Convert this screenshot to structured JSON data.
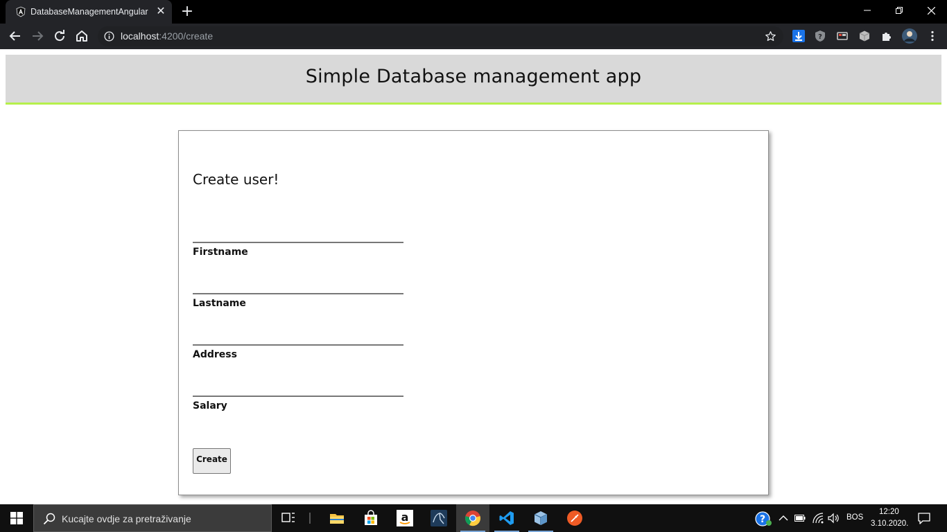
{
  "browser": {
    "tab_title": "DatabaseManagementAngular",
    "url_host": "localhost",
    "url_rest": ":4200/create",
    "window_controls": [
      "minimize",
      "restore",
      "close"
    ]
  },
  "app": {
    "title": "Simple Database management app"
  },
  "form": {
    "heading": "Create user!",
    "fields": [
      {
        "label": "Firstname",
        "value": ""
      },
      {
        "label": "Lastname",
        "value": ""
      },
      {
        "label": "Address",
        "value": ""
      },
      {
        "label": "Salary",
        "value": ""
      }
    ],
    "submit_label": "Create"
  },
  "taskbar": {
    "search_placeholder": "Kucajte ovdje za pretraživanje",
    "language": "BOS",
    "time": "12:20",
    "date": "3.10.2020.",
    "apps": [
      "task-view",
      "file-explorer",
      "microsoft-store",
      "amazon",
      "mysql-workbench",
      "chrome",
      "vscode",
      "virtualbox",
      "postman"
    ]
  },
  "colors": {
    "header_bg": "#d9d9d9",
    "header_accent": "#b5f04b",
    "chrome_dark": "#232428"
  }
}
